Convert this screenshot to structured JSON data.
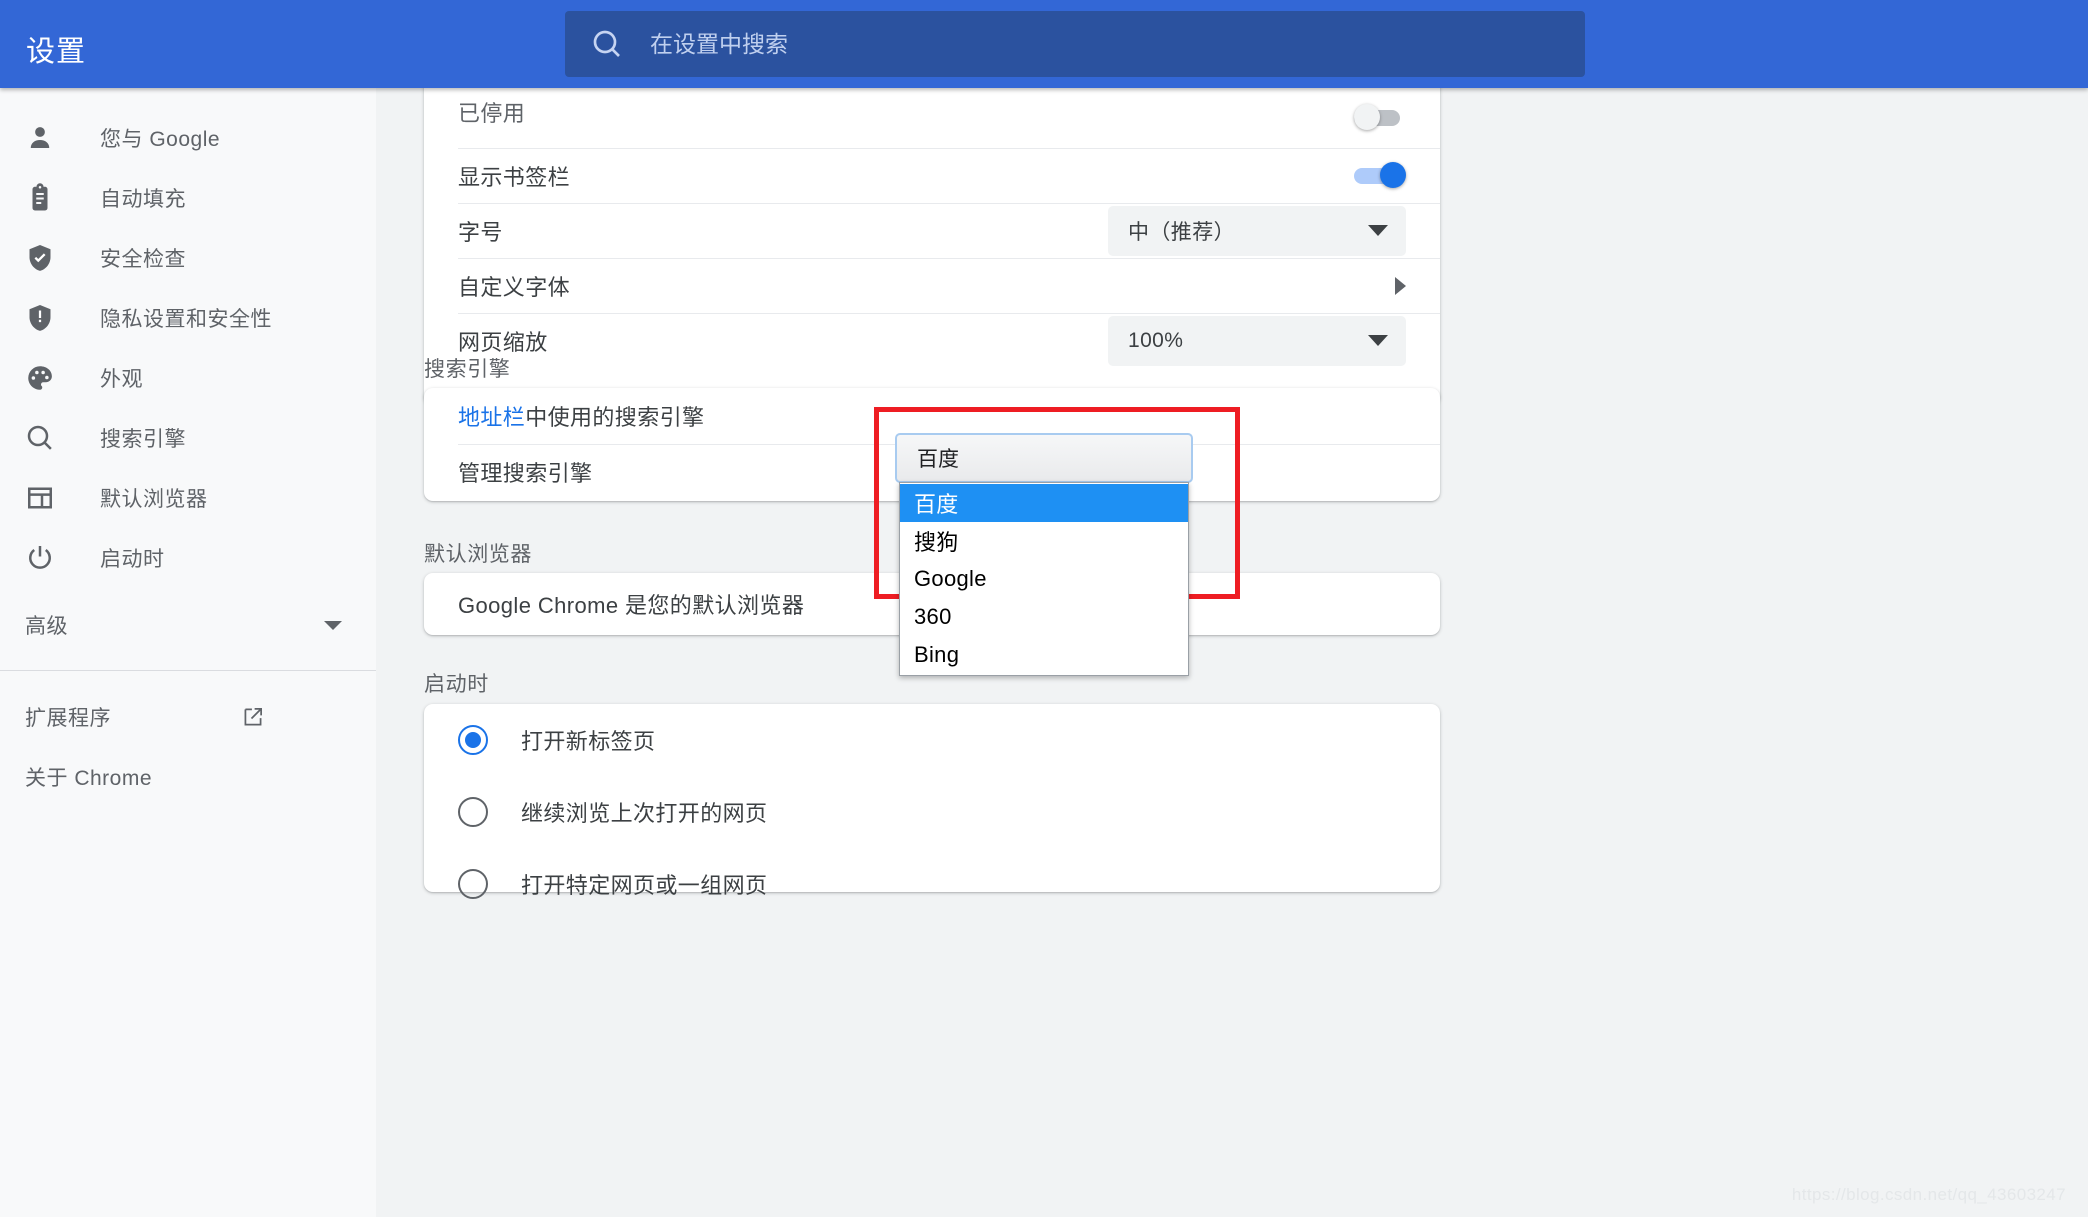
{
  "header": {
    "title": "设置",
    "search_placeholder": "在设置中搜索",
    "search_value": "",
    "search_icon": "search-icon",
    "bg_color": "#3367d6"
  },
  "sidebar": {
    "items": [
      {
        "label": "您与 Google",
        "icon": "person-icon"
      },
      {
        "label": "自动填充",
        "icon": "clipboard-icon"
      },
      {
        "label": "安全检查",
        "icon": "shield-check-icon"
      },
      {
        "label": "隐私设置和安全性",
        "icon": "shield-icon"
      },
      {
        "label": "外观",
        "icon": "palette-icon"
      },
      {
        "label": "搜索引擎",
        "icon": "search-icon"
      },
      {
        "label": "默认浏览器",
        "icon": "browser-window-icon"
      },
      {
        "label": "启动时",
        "icon": "power-icon"
      }
    ],
    "advanced": {
      "label": "高级",
      "icon": "chevron-down-icon"
    },
    "footer_items": [
      {
        "label": "扩展程序",
        "icon": "external-link-icon",
        "has_external": true
      },
      {
        "label": "关于 Chrome",
        "icon": "",
        "has_external": false
      }
    ]
  },
  "appearance_card": {
    "rows": [
      {
        "label": "已停用",
        "control": "toggle",
        "toggle_on": false
      },
      {
        "label": "显示书签栏",
        "control": "toggle",
        "toggle_on": true
      },
      {
        "label": "字号",
        "control": "select",
        "value": "中（推荐）"
      },
      {
        "label": "自定义字体",
        "control": "arrow"
      },
      {
        "label": "网页缩放",
        "control": "select",
        "value": "100%"
      }
    ]
  },
  "search_engine_section": {
    "title": "搜索引擎",
    "row_link_text": "地址栏",
    "row_label_rest": "中使用的搜索引擎",
    "manage_label": "管理搜索引擎",
    "selected_value": "百度",
    "options": [
      "百度",
      "搜狗",
      "Google",
      "360",
      "Bing"
    ],
    "selected_index": 0,
    "highlight_color": "#ee1d23",
    "option_highlight_color": "#1e90f3"
  },
  "default_browser_section": {
    "title": "默认浏览器",
    "status_text": "Google Chrome 是您的默认浏览器"
  },
  "startup_section": {
    "title": "启动时",
    "options": [
      {
        "label": "打开新标签页",
        "selected": true
      },
      {
        "label": "继续浏览上次打开的网页",
        "selected": false
      },
      {
        "label": "打开特定网页或一组网页",
        "selected": false
      }
    ]
  },
  "watermark": {
    "text": "https://blog.csdn.net/qq_43603247"
  }
}
